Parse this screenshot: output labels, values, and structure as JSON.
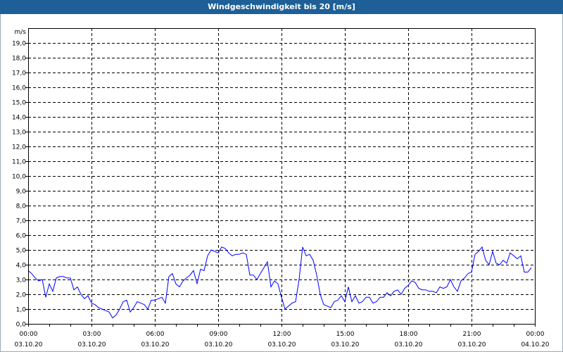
{
  "title": "Windgeschwindigkeit bis 20 [m/s]",
  "chart_data": {
    "type": "line",
    "title": "Windgeschwindigkeit bis 20 [m/s]",
    "ylabel": "m/s",
    "xlabel": "",
    "ylim": [
      0,
      20
    ],
    "xlim_hours": [
      0,
      24
    ],
    "grid": true,
    "y_ticks": [
      "0,0",
      "1,0",
      "2,0",
      "3,0",
      "4,0",
      "5,0",
      "6,0",
      "7,0",
      "8,0",
      "9,0",
      "10,0",
      "11,0",
      "12,0",
      "13,0",
      "14,0",
      "15,0",
      "16,0",
      "17,0",
      "18,0",
      "19,0"
    ],
    "x_ticks": [
      {
        "time": "00:00",
        "date": "03.10.20"
      },
      {
        "time": "03:00",
        "date": "03.10.20"
      },
      {
        "time": "06:00",
        "date": "03.10.20"
      },
      {
        "time": "09:00",
        "date": "03.10.20"
      },
      {
        "time": "12:00",
        "date": "03.10.20"
      },
      {
        "time": "15:00",
        "date": "03.10.20"
      },
      {
        "time": "18:00",
        "date": "03.10.20"
      },
      {
        "time": "21:00",
        "date": "03.10.20"
      },
      {
        "time": "00:00",
        "date": "04.10.20"
      }
    ],
    "series": [
      {
        "name": "Windgeschwindigkeit",
        "color": "#0000ff",
        "start": "00:00",
        "interval_minutes": 10,
        "values": [
          3.6,
          3.4,
          3.1,
          2.9,
          3.0,
          1.8,
          2.7,
          2.2,
          3.1,
          3.2,
          3.2,
          3.1,
          3.1,
          2.3,
          2.5,
          2.0,
          1.7,
          1.9,
          1.4,
          1.3,
          1.1,
          1.0,
          0.9,
          0.8,
          0.4,
          0.6,
          1.0,
          1.5,
          1.6,
          0.8,
          1.1,
          1.5,
          1.4,
          1.3,
          1.0,
          1.6,
          1.6,
          1.7,
          1.8,
          1.4,
          3.2,
          3.4,
          2.7,
          2.5,
          2.9,
          3.1,
          3.3,
          3.6,
          2.7,
          3.7,
          3.6,
          4.6,
          5.0,
          4.9,
          4.8,
          5.2,
          5.1,
          4.8,
          4.6,
          4.7,
          4.7,
          4.8,
          4.7,
          3.3,
          3.3,
          3.0,
          3.4,
          3.8,
          4.2,
          2.5,
          2.9,
          2.7,
          1.8,
          1.0,
          1.2,
          1.4,
          1.5,
          3.0,
          5.2,
          4.6,
          4.7,
          4.3,
          3.3,
          2.0,
          1.3,
          1.2,
          1.1,
          1.5,
          1.6,
          1.9,
          1.5,
          2.5,
          1.5,
          1.9,
          1.4,
          1.5,
          1.8,
          1.8,
          1.4,
          1.5,
          1.8,
          1.8,
          2.1,
          1.9,
          2.2,
          2.3,
          2.0,
          2.4,
          2.6,
          2.9,
          2.8,
          2.4,
          2.3,
          2.3,
          2.2,
          2.2,
          2.1,
          2.5,
          2.4,
          2.5,
          3.0,
          2.5,
          2.2,
          2.9,
          3.1,
          3.4,
          3.5,
          4.7,
          4.9,
          5.2,
          4.3,
          4.0,
          4.9,
          4.1,
          4.0,
          4.3,
          4.1,
          4.8,
          4.6,
          4.4,
          4.6,
          3.5,
          3.5,
          3.8
        ]
      }
    ]
  }
}
